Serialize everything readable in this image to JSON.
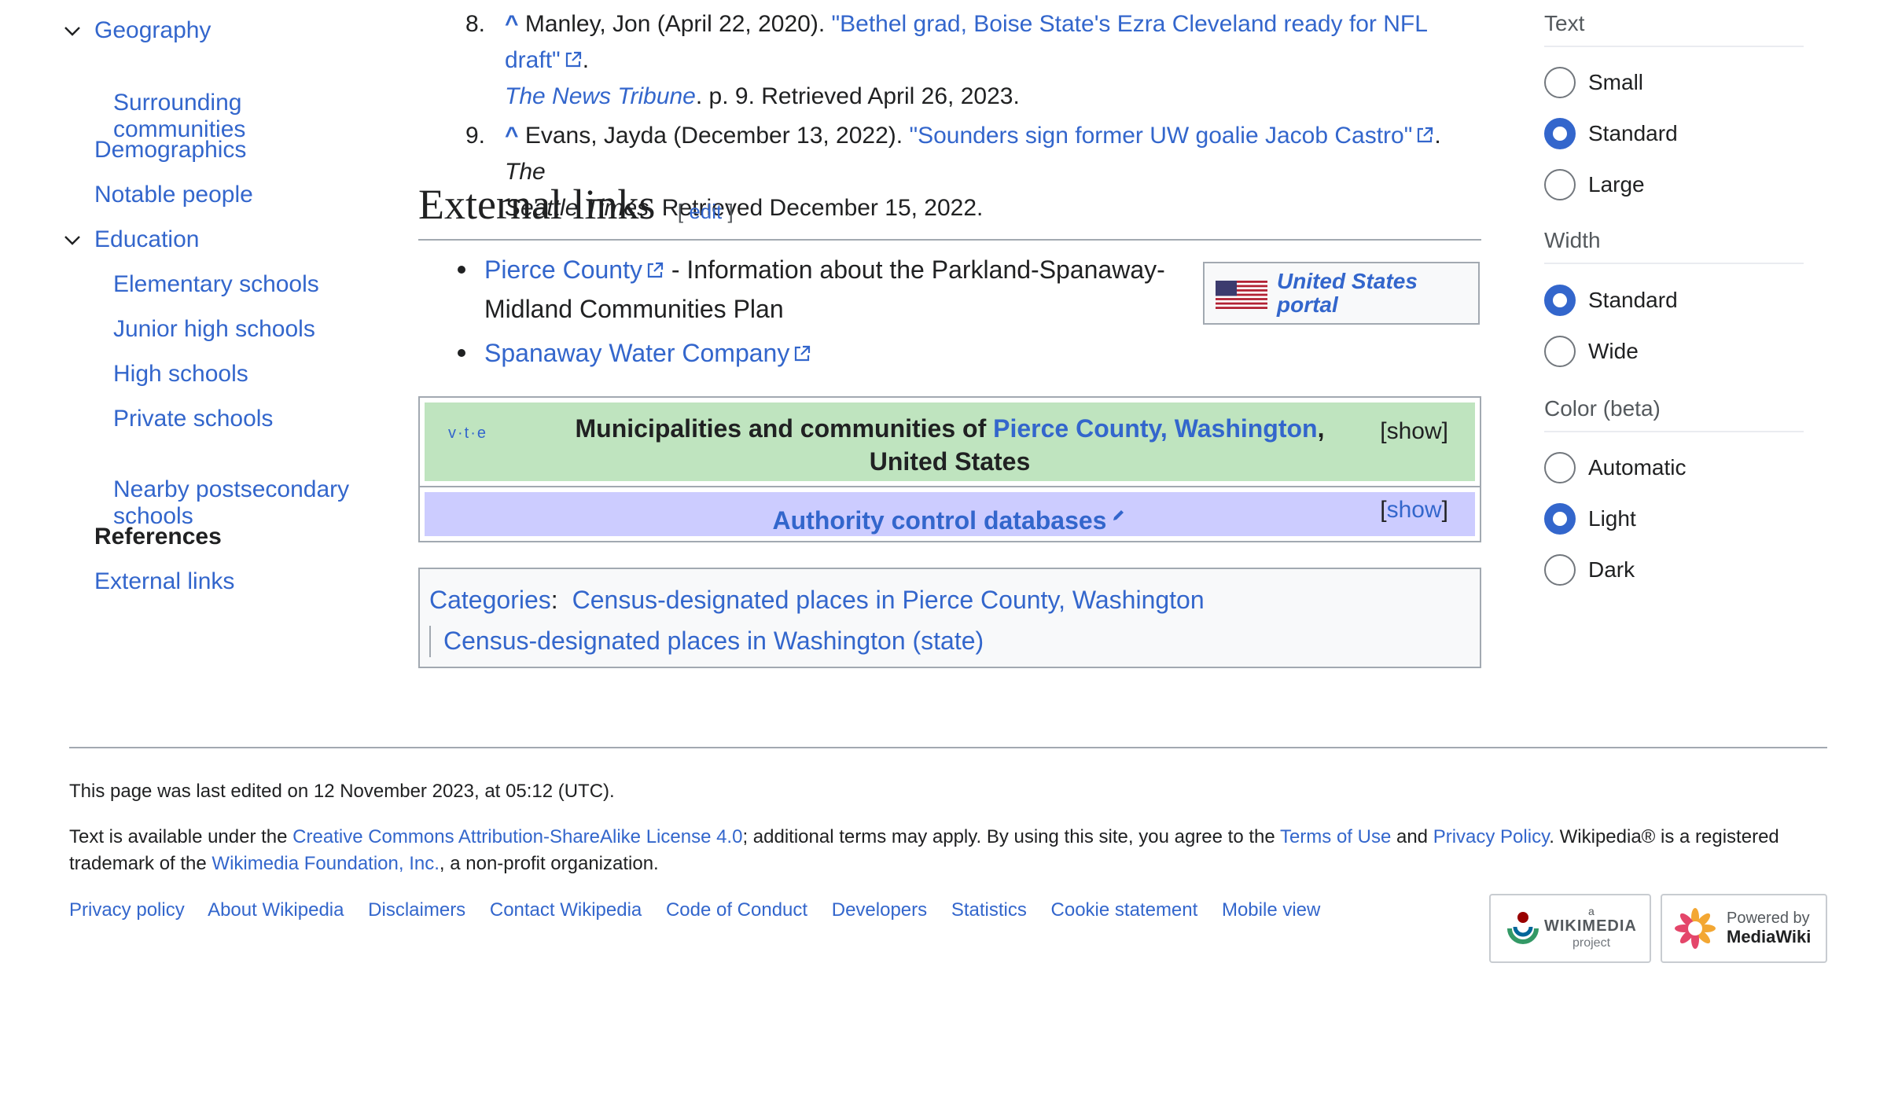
{
  "toc": {
    "items": [
      {
        "label": "Geography",
        "level": 1,
        "expanded": true
      },
      {
        "label": "Surrounding\ncommunities",
        "level": 2
      },
      {
        "label": "Demographics",
        "level": 1
      },
      {
        "label": "Notable people",
        "level": 1
      },
      {
        "label": "Education",
        "level": 1,
        "expanded": true
      },
      {
        "label": "Elementary schools",
        "level": 2
      },
      {
        "label": "Junior high schools",
        "level": 2
      },
      {
        "label": "High schools",
        "level": 2
      },
      {
        "label": "Private schools",
        "level": 2
      },
      {
        "label": "Nearby postsecondary\nschools",
        "level": 2
      },
      {
        "label": "References",
        "level": 1,
        "active": true
      },
      {
        "label": "External links",
        "level": 1
      }
    ]
  },
  "references": [
    {
      "num": "8.",
      "caret": "^",
      "pre": " Manley, Jon (April 22, 2020). ",
      "link": "\"Bethel grad, Boise State's Ezra Cleveland ready for NFL draft\"",
      "post": ".",
      "line2_italic": "The News Tribune",
      "line2": ". p. 9. Retrieved April 26, 2023."
    },
    {
      "num": "9.",
      "caret": "^",
      "pre": " Evans, Jayda (December 13, 2022). ",
      "link": "\"Sounders sign former UW goalie Jacob Castro\"",
      "post": ". ",
      "post_italic": "The",
      "line2_italic": "Seattle Times",
      "line2": ". Retrieved December 15, 2022."
    }
  ],
  "external_links": {
    "heading": "External links",
    "edit_open": "[ ",
    "edit_label": "edit",
    "edit_close": " ]",
    "items": [
      {
        "link": "Pierce County",
        "text": " - Information about the Parkland-Spanaway-",
        "text2": "Midland Communities Plan"
      },
      {
        "link": "Spanaway Water Company",
        "text": "",
        "text2": ""
      }
    ],
    "portal": {
      "label": "United States portal"
    }
  },
  "navbox": {
    "vte": "v·t·e",
    "title_pre": "Municipalities and communities of ",
    "title_link": "Pierce County, Washington",
    "title_post": ",",
    "title_line2": "United States",
    "show_label": "[show]",
    "authority_title": "Authority control databases",
    "authority_show_open": "[",
    "authority_show_link": "show",
    "authority_show_close": "]"
  },
  "categories": {
    "label": "Categories",
    "colon": ":",
    "items": [
      "Census-designated places in Pierce County, Washington",
      "Census-designated places in Washington (state)"
    ]
  },
  "appearance": {
    "groups": [
      {
        "heading": "Text",
        "options": [
          {
            "label": "Small",
            "checked": false
          },
          {
            "label": "Standard",
            "checked": true
          },
          {
            "label": "Large",
            "checked": false
          }
        ]
      },
      {
        "heading": "Width",
        "options": [
          {
            "label": "Standard",
            "checked": true
          },
          {
            "label": "Wide",
            "checked": false
          }
        ]
      },
      {
        "heading": "Color (beta)",
        "options": [
          {
            "label": "Automatic",
            "checked": false
          },
          {
            "label": "Light",
            "checked": true
          },
          {
            "label": "Dark",
            "checked": false
          }
        ]
      }
    ]
  },
  "footer": {
    "last_edited": "This page was last edited on 12 November 2023, at 05:12 (UTC).",
    "license_1": "Text is available under the ",
    "license_link": "Creative Commons Attribution-ShareAlike License 4.0",
    "license_2": "; additional terms may apply. By using this site, you agree to the ",
    "terms_link": "Terms of Use",
    "and": " and ",
    "privacy_link": "Privacy Policy",
    "license_3": ". Wikipedia® is a registered",
    "license_4": "trademark of the ",
    "foundation_link": "Wikimedia Foundation, Inc.",
    "license_5": ", a non-profit organization.",
    "links": [
      "Privacy policy",
      "About Wikipedia",
      "Disclaimers",
      "Contact Wikipedia",
      "Code of Conduct",
      "Developers",
      "Statistics",
      "Cookie statement",
      "Mobile view"
    ],
    "wikimedia_badge": {
      "small": "a",
      "name": "WIKIMEDIA",
      "sub": "project"
    },
    "mediawiki_badge": {
      "line1": "Powered by",
      "line2": "MediaWiki"
    }
  },
  "colors": {
    "link": "#3366cc",
    "navbox_title_bg": "#bfe4bf",
    "authority_bg": "#ccccff",
    "radio_checked": "#3366cc"
  },
  "icons": [
    "chevron-down-icon",
    "external-link-icon",
    "us-flag-icon",
    "pencil-icon",
    "wikimedia-logo-icon",
    "mediawiki-logo-icon"
  ]
}
